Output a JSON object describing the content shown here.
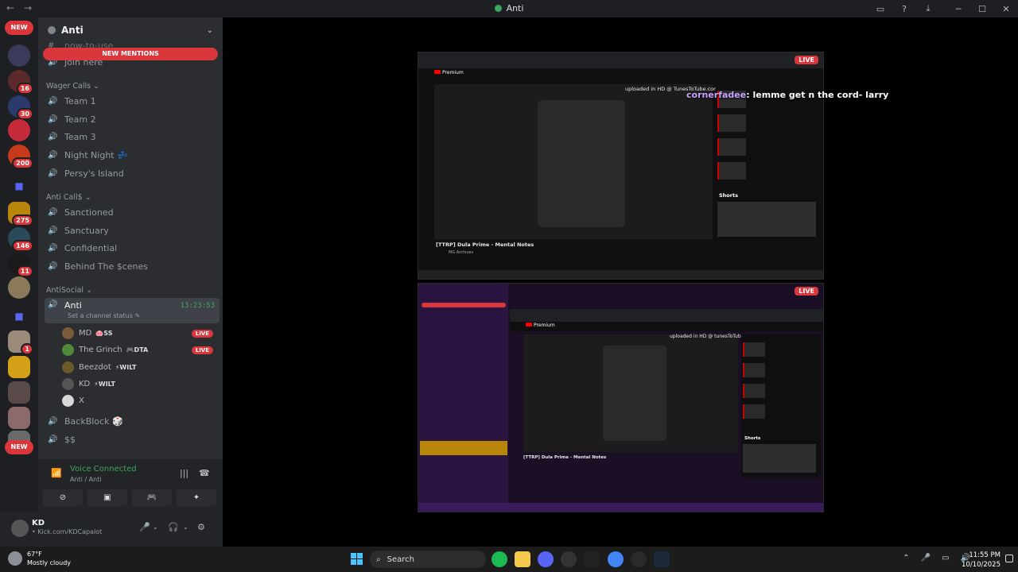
{
  "window": {
    "title": "Anti",
    "back": "←",
    "forward": "→",
    "minimize": "─",
    "maximize": "☐",
    "close": "✕"
  },
  "rail": {
    "new_top": "NEW",
    "new_bottom": "NEW",
    "badges": [
      "16",
      "30",
      "200",
      "275",
      "146",
      "11",
      "1"
    ]
  },
  "server": {
    "name": "Anti",
    "new_mentions": "NEW MENTIONS"
  },
  "channels": {
    "top_partial": "now-to-use",
    "join_here": "Join here",
    "wager_category": "Wager Calls",
    "wager": [
      "Team 1",
      "Team 2",
      "Team 3",
      "Night Night 💤",
      "Persy's Island"
    ],
    "anti_category": "Anti Call$",
    "anti": [
      "Sanctioned",
      "Sanctuary",
      "Confidential",
      "Behind The $cenes"
    ],
    "social_category": "AntiSocial",
    "active": {
      "name": "Anti",
      "time": "13:23:53",
      "status": "Set a channel status ✎"
    },
    "voice_users": [
      {
        "name": "MD",
        "tag": "🐽SS",
        "live": "LIVE",
        "color": "#7a5c3a"
      },
      {
        "name": "The Grinch",
        "tag": "🎮DTA",
        "live": "LIVE",
        "color": "#4f8a3a"
      },
      {
        "name": "Beezdot",
        "tag": "⚡WILT",
        "live": "",
        "color": "#6b5a2a"
      },
      {
        "name": "KD",
        "tag": "⚡WILT",
        "live": "",
        "color": "#555"
      },
      {
        "name": "X",
        "tag": "",
        "live": "",
        "color": "#d8d8d8"
      }
    ],
    "after": [
      "BackBlock 🎲",
      "$$"
    ]
  },
  "voice_panel": {
    "status": "Voice Connected",
    "location": "Anti / Anti"
  },
  "user": {
    "name": "KD",
    "status": "• Kick.com/KDCapalot"
  },
  "streams": {
    "top": {
      "live": "LIVE",
      "chat_name": "cornerfadee",
      "chat_msg": ": lemme get n the cord- larry",
      "uploaded": "uploaded in HD @ TunesToTube.com",
      "video_title": "[TTRP] Dula Prime - Mental Notes",
      "channel": "MG Archives",
      "shorts": "Shorts",
      "premium": "Premium"
    },
    "bottom": {
      "live": "LIVE",
      "uploaded": "uploaded in HD @ tunesToTube.com",
      "video_title": "[TTRP] Dula Prime - Mental Notes",
      "shorts": "Shorts",
      "premium": "Premium"
    }
  },
  "taskbar": {
    "temp": "67°F",
    "weather": "Mostly cloudy",
    "search": "Search",
    "time": "11:55 PM",
    "date": "10/10/2025"
  }
}
